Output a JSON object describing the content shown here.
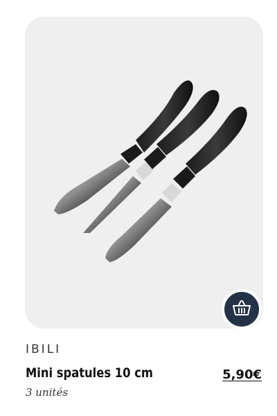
{
  "product": {
    "brand": "IBILI",
    "name": "Mini spatules 10 cm",
    "units": "3 unités",
    "price": "5,90€",
    "image_icon": "spatulas-product-image"
  },
  "cart_button": {
    "icon": "basket-icon",
    "color": "#243245"
  }
}
